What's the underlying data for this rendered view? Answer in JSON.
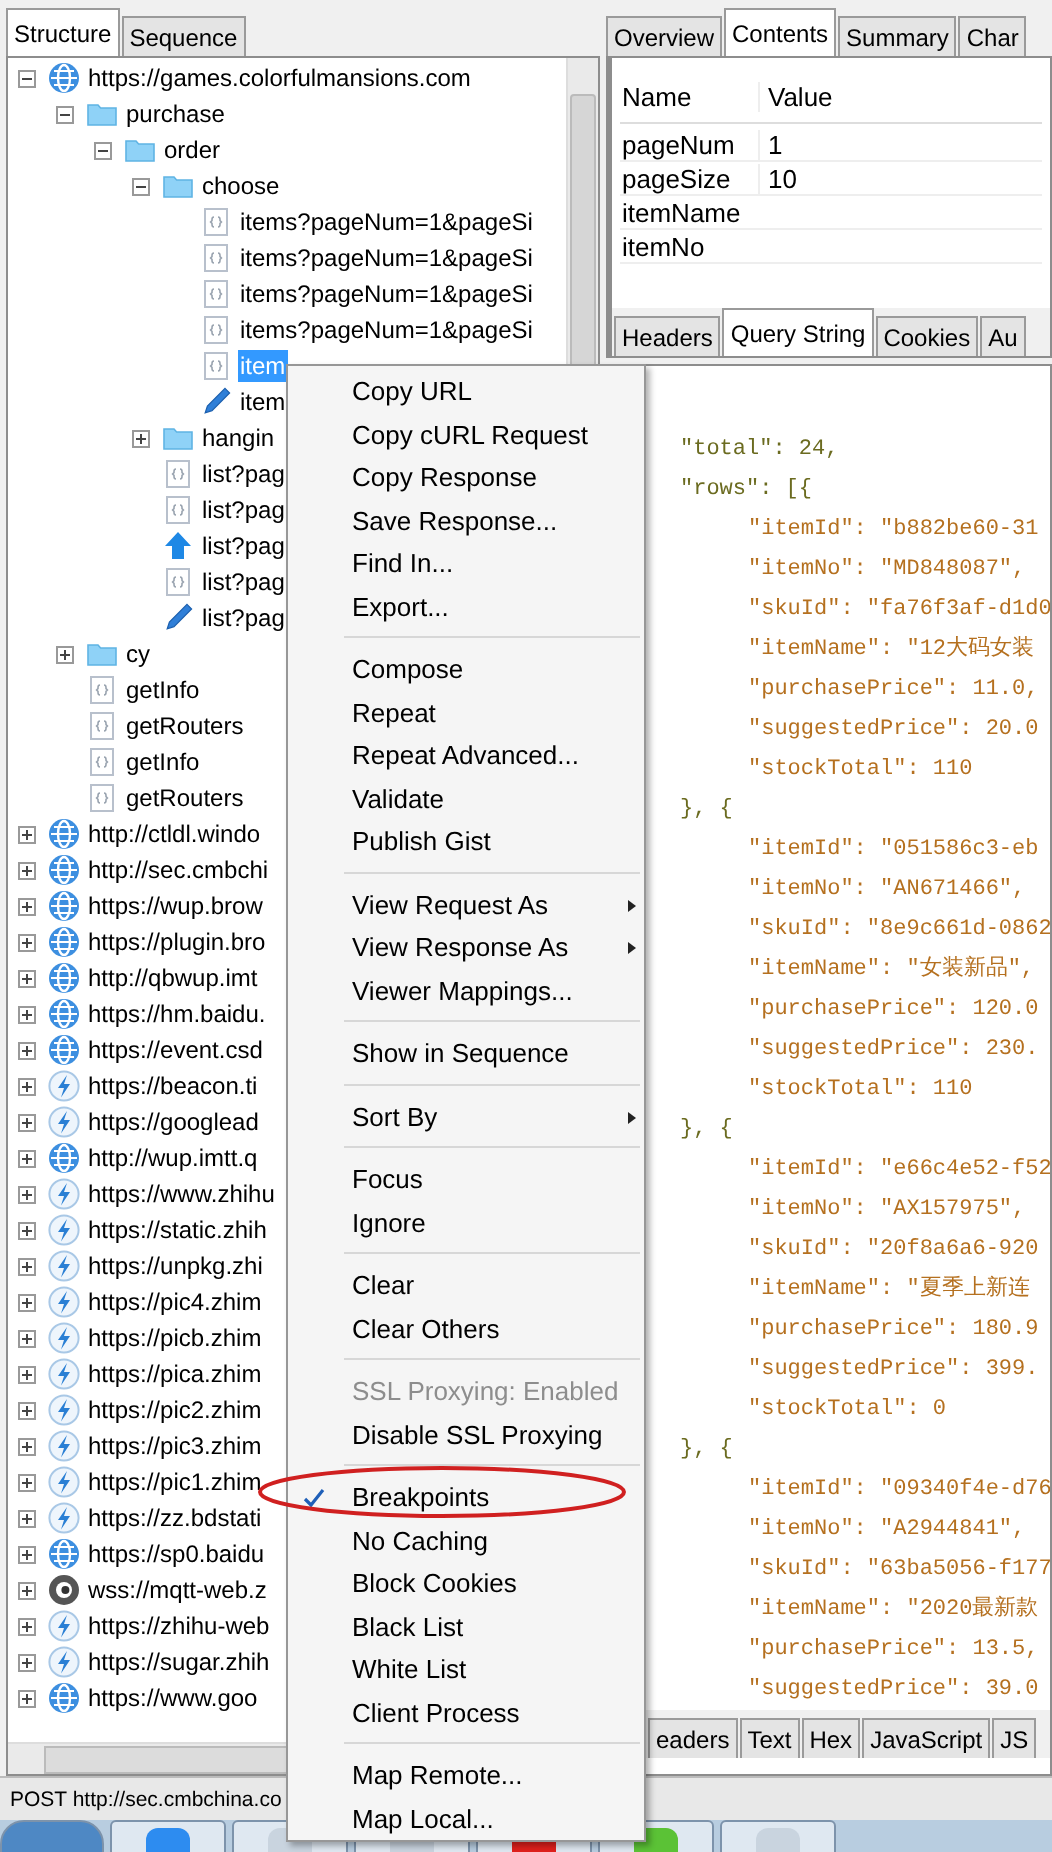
{
  "left_tabs": [
    {
      "label": "Structure",
      "selected": true
    },
    {
      "label": "Sequence",
      "selected": false
    }
  ],
  "tree": [
    {
      "label": "https://games.colorfulmansions.com",
      "kind": "host",
      "expanded": true,
      "selected": false,
      "children": [
        {
          "label": "purchase",
          "kind": "folder",
          "expanded": true,
          "selected": false,
          "children": [
            {
              "label": "order",
              "kind": "folder",
              "expanded": true,
              "selected": false,
              "children": [
                {
                  "label": "choose",
                  "kind": "folder",
                  "expanded": true,
                  "selected": false,
                  "children": [
                    {
                      "label": "items?pageNum=1&pageSi",
                      "kind": "request",
                      "selected": false
                    },
                    {
                      "label": "items?pageNum=1&pageSi",
                      "kind": "request",
                      "selected": false
                    },
                    {
                      "label": "items?pageNum=1&pageSi",
                      "kind": "request",
                      "selected": false
                    },
                    {
                      "label": "items?pageNum=1&pageSi",
                      "kind": "request",
                      "selected": false
                    },
                    {
                      "label": "item",
                      "kind": "request",
                      "selected": true
                    },
                    {
                      "label": "item",
                      "kind": "edit",
                      "selected": false
                    }
                  ]
                },
                {
                  "label": "hangin",
                  "kind": "folder",
                  "expanded": false,
                  "selected": false
                },
                {
                  "label": "list?pag",
                  "kind": "request",
                  "selected": false
                },
                {
                  "label": "list?pag",
                  "kind": "request",
                  "selected": false
                },
                {
                  "label": "list?pag",
                  "kind": "upload",
                  "selected": false
                },
                {
                  "label": "list?pag",
                  "kind": "request",
                  "selected": false
                },
                {
                  "label": "list?pag",
                  "kind": "edit",
                  "selected": false
                }
              ]
            }
          ]
        },
        {
          "label": "cy",
          "kind": "folder",
          "expanded": false,
          "selected": false
        },
        {
          "label": "getInfo",
          "kind": "request",
          "selected": false
        },
        {
          "label": "getRouters",
          "kind": "request",
          "selected": false
        },
        {
          "label": "getInfo",
          "kind": "request",
          "selected": false
        },
        {
          "label": "getRouters",
          "kind": "request",
          "selected": false
        }
      ]
    },
    {
      "label": "http://ctldl.windo",
      "kind": "host",
      "expanded": false,
      "selected": false
    },
    {
      "label": "http://sec.cmbchi",
      "kind": "host",
      "expanded": false,
      "selected": false
    },
    {
      "label": "https://wup.brow",
      "kind": "host",
      "expanded": false,
      "selected": false
    },
    {
      "label": "https://plugin.bro",
      "kind": "host",
      "expanded": false,
      "selected": false
    },
    {
      "label": "http://qbwup.imt",
      "kind": "host",
      "expanded": false,
      "selected": false
    },
    {
      "label": "https://hm.baidu.",
      "kind": "host",
      "expanded": false,
      "selected": false
    },
    {
      "label": "https://event.csd",
      "kind": "host",
      "expanded": false,
      "selected": false
    },
    {
      "label": "https://beacon.ti",
      "kind": "lightning",
      "expanded": false,
      "selected": false
    },
    {
      "label": "https://googlead",
      "kind": "lightning",
      "expanded": false,
      "selected": false
    },
    {
      "label": "http://wup.imtt.q",
      "kind": "host",
      "expanded": false,
      "selected": false
    },
    {
      "label": "https://www.zhihu",
      "kind": "lightning",
      "expanded": false,
      "selected": false
    },
    {
      "label": "https://static.zhih",
      "kind": "lightning",
      "expanded": false,
      "selected": false
    },
    {
      "label": "https://unpkg.zhi",
      "kind": "lightning",
      "expanded": false,
      "selected": false
    },
    {
      "label": "https://pic4.zhim",
      "kind": "lightning",
      "expanded": false,
      "selected": false
    },
    {
      "label": "https://picb.zhim",
      "kind": "lightning",
      "expanded": false,
      "selected": false
    },
    {
      "label": "https://pica.zhim",
      "kind": "lightning",
      "expanded": false,
      "selected": false
    },
    {
      "label": "https://pic2.zhim",
      "kind": "lightning",
      "expanded": false,
      "selected": false
    },
    {
      "label": "https://pic3.zhim",
      "kind": "lightning",
      "expanded": false,
      "selected": false
    },
    {
      "label": "https://pic1.zhim",
      "kind": "lightning",
      "expanded": false,
      "selected": false
    },
    {
      "label": "https://zz.bdstati",
      "kind": "lightning",
      "expanded": false,
      "selected": false
    },
    {
      "label": "https://sp0.baidu",
      "kind": "host",
      "expanded": false,
      "selected": false
    },
    {
      "label": "wss://mqtt-web.z",
      "kind": "socket",
      "expanded": false,
      "selected": false
    },
    {
      "label": "https://zhihu-web",
      "kind": "lightning",
      "expanded": false,
      "selected": false
    },
    {
      "label": "https://sugar.zhih",
      "kind": "lightning",
      "expanded": false,
      "selected": false
    },
    {
      "label": "https://www.goo",
      "kind": "host",
      "expanded": false,
      "selected": false
    }
  ],
  "right_tabs": [
    {
      "label": "Overview",
      "selected": false
    },
    {
      "label": "Contents",
      "selected": true
    },
    {
      "label": "Summary",
      "selected": false
    },
    {
      "label": "Char",
      "selected": false
    }
  ],
  "params_table": {
    "columns": [
      "Name",
      "Value"
    ],
    "rows": [
      {
        "name": "pageNum",
        "value": "1"
      },
      {
        "name": "pageSize",
        "value": "10"
      },
      {
        "name": "itemName"
      },
      {
        "name": "itemNo"
      }
    ]
  },
  "request_tabs": [
    {
      "label": "Headers",
      "selected": false
    },
    {
      "label": "Query String",
      "selected": true
    },
    {
      "label": "Cookies",
      "selected": false
    },
    {
      "label": "Au",
      "selected": false
    }
  ],
  "response_lines": [
    {
      "kind": "top",
      "text": "\"total\": 24,"
    },
    {
      "kind": "top",
      "text": "\"rows\": [{"
    },
    {
      "kind": "field",
      "text": "\"itemId\": \"b882be60-31"
    },
    {
      "kind": "field",
      "text": "\"itemNo\": \"MD848087\","
    },
    {
      "kind": "field",
      "text": "\"skuId\": \"fa76f3af-d1d0"
    },
    {
      "kind": "field",
      "text": "\"itemName\": \"12大码女装"
    },
    {
      "kind": "field",
      "text": "\"purchasePrice\": 11.0,"
    },
    {
      "kind": "field",
      "text": "\"suggestedPrice\": 20.0"
    },
    {
      "kind": "field",
      "text": "\"stockTotal\": 110"
    },
    {
      "kind": "top",
      "text": "}, {"
    },
    {
      "kind": "field",
      "text": "\"itemId\": \"051586c3-eb"
    },
    {
      "kind": "field",
      "text": "\"itemNo\": \"AN671466\","
    },
    {
      "kind": "field",
      "text": "\"skuId\": \"8e9c661d-0862"
    },
    {
      "kind": "field",
      "text": "\"itemName\": \"女装新品\","
    },
    {
      "kind": "field",
      "text": "\"purchasePrice\": 120.0"
    },
    {
      "kind": "field",
      "text": "\"suggestedPrice\": 230."
    },
    {
      "kind": "field",
      "text": "\"stockTotal\": 110"
    },
    {
      "kind": "top",
      "text": "}, {"
    },
    {
      "kind": "field",
      "text": "\"itemId\": \"e66c4e52-f52"
    },
    {
      "kind": "field",
      "text": "\"itemNo\": \"AX157975\","
    },
    {
      "kind": "field",
      "text": "\"skuId\": \"20f8a6a6-920"
    },
    {
      "kind": "field",
      "text": "\"itemName\": \"夏季上新连"
    },
    {
      "kind": "field",
      "text": "\"purchasePrice\": 180.9"
    },
    {
      "kind": "field",
      "text": "\"suggestedPrice\": 399."
    },
    {
      "kind": "field",
      "text": "\"stockTotal\": 0"
    },
    {
      "kind": "top",
      "text": "}, {"
    },
    {
      "kind": "field",
      "text": "\"itemId\": \"09340f4e-d76"
    },
    {
      "kind": "field",
      "text": "\"itemNo\": \"A2944841\","
    },
    {
      "kind": "field",
      "text": "\"skuId\": \"63ba5056-f177"
    },
    {
      "kind": "field",
      "text": "\"itemName\": \"2020最新款"
    },
    {
      "kind": "field",
      "text": "\"purchasePrice\": 13.5,"
    },
    {
      "kind": "field",
      "text": "\"suggestedPrice\": 39.0"
    }
  ],
  "response_tabs": [
    {
      "label": "eaders",
      "selected": false
    },
    {
      "label": "Text",
      "selected": false
    },
    {
      "label": "Hex",
      "selected": false
    },
    {
      "label": "JavaScript",
      "selected": false
    },
    {
      "label": "JS",
      "selected": false
    }
  ],
  "status_bar": "POST http://sec.cmbchina.co",
  "context_menu": [
    [
      {
        "label": "Copy URL",
        "submenu": false,
        "disabled": false,
        "checked": false
      },
      {
        "label": "Copy cURL Request",
        "submenu": false,
        "disabled": false,
        "checked": false
      },
      {
        "label": "Copy Response",
        "submenu": false,
        "disabled": false,
        "checked": false
      },
      {
        "label": "Save Response...",
        "submenu": false,
        "disabled": false,
        "checked": false
      },
      {
        "label": "Find In...",
        "submenu": false,
        "disabled": false,
        "checked": false
      },
      {
        "label": "Export...",
        "submenu": false,
        "disabled": false,
        "checked": false
      }
    ],
    [
      {
        "label": "Compose",
        "submenu": false,
        "disabled": false,
        "checked": false
      },
      {
        "label": "Repeat",
        "submenu": false,
        "disabled": false,
        "checked": false
      },
      {
        "label": "Repeat Advanced...",
        "submenu": false,
        "disabled": false,
        "checked": false
      },
      {
        "label": "Validate",
        "submenu": false,
        "disabled": false,
        "checked": false
      },
      {
        "label": "Publish Gist",
        "submenu": false,
        "disabled": false,
        "checked": false
      }
    ],
    [
      {
        "label": "View Request As",
        "submenu": true,
        "disabled": false,
        "checked": false
      },
      {
        "label": "View Response As",
        "submenu": true,
        "disabled": false,
        "checked": false
      },
      {
        "label": "Viewer Mappings...",
        "submenu": false,
        "disabled": false,
        "checked": false
      }
    ],
    [
      {
        "label": "Show in Sequence",
        "submenu": false,
        "disabled": false,
        "checked": false
      }
    ],
    [
      {
        "label": "Sort By",
        "submenu": true,
        "disabled": false,
        "checked": false
      }
    ],
    [
      {
        "label": "Focus",
        "submenu": false,
        "disabled": false,
        "checked": false
      },
      {
        "label": "Ignore",
        "submenu": false,
        "disabled": false,
        "checked": false
      }
    ],
    [
      {
        "label": "Clear",
        "submenu": false,
        "disabled": false,
        "checked": false
      },
      {
        "label": "Clear Others",
        "submenu": false,
        "disabled": false,
        "checked": false
      }
    ],
    [
      {
        "label": "SSL Proxying: Enabled",
        "submenu": false,
        "disabled": true,
        "checked": false
      },
      {
        "label": "Disable SSL Proxying",
        "submenu": false,
        "disabled": false,
        "checked": false
      }
    ],
    [
      {
        "label": "Breakpoints",
        "submenu": false,
        "disabled": false,
        "checked": true
      },
      {
        "label": "No Caching",
        "submenu": false,
        "disabled": false,
        "checked": false
      },
      {
        "label": "Block Cookies",
        "submenu": false,
        "disabled": false,
        "checked": false
      },
      {
        "label": "Black List",
        "submenu": false,
        "disabled": false,
        "checked": false
      },
      {
        "label": "White List",
        "submenu": false,
        "disabled": false,
        "checked": false
      },
      {
        "label": "Client Process",
        "submenu": false,
        "disabled": false,
        "checked": false
      }
    ],
    [
      {
        "label": "Map Remote...",
        "submenu": false,
        "disabled": false,
        "checked": false
      },
      {
        "label": "Map Local...",
        "submenu": false,
        "disabled": false,
        "checked": false
      }
    ]
  ],
  "taskbar": [
    {
      "kind": "start"
    },
    {
      "kind": "blue"
    },
    {
      "kind": "plain"
    },
    {
      "kind": "plain"
    },
    {
      "kind": "red"
    },
    {
      "kind": "green"
    },
    {
      "kind": "plain"
    }
  ]
}
